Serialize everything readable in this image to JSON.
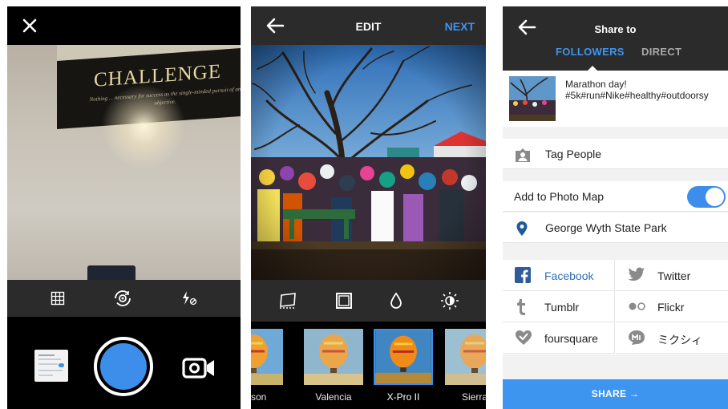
{
  "camera": {
    "poster_title": "CHALLENGE",
    "poster_tagline": "Nothing ... necessary for success as the single-minded pursuit of an objective."
  },
  "edit": {
    "title": "EDIT",
    "next_label": "NEXT",
    "filters": [
      {
        "name": "udson"
      },
      {
        "name": "Valencia"
      },
      {
        "name": "X-Pro II",
        "selected": true
      },
      {
        "name": "Sierra"
      }
    ]
  },
  "share": {
    "title": "Share to",
    "tabs": [
      "FOLLOWERS",
      "DIRECT"
    ],
    "active_tab": "FOLLOWERS",
    "caption_line1": "Marathon day!",
    "caption_line2": "#5k#run#Nike#healthy#outdoorsy",
    "tag_people": "Tag People",
    "photo_map": "Add to Photo Map",
    "photo_map_enabled": true,
    "location": "George Wyth State Park",
    "services": [
      "Facebook",
      "Twitter",
      "Tumblr",
      "Flickr",
      "foursquare",
      "ミクシィ"
    ],
    "facebook_enabled": true,
    "share_label": "SHARE →"
  },
  "colors": {
    "accent": "#3d95f0",
    "dark_bar": "#2b2b2b"
  }
}
